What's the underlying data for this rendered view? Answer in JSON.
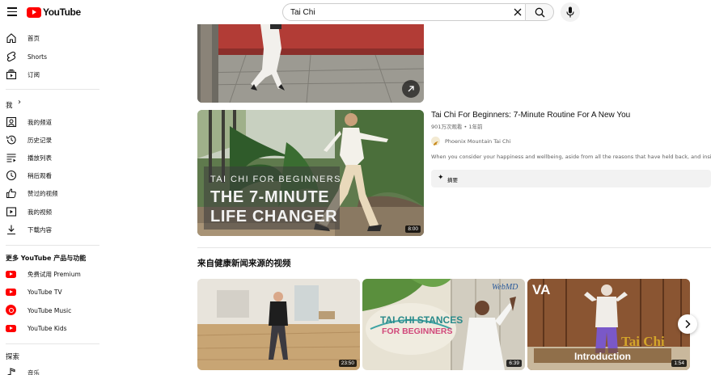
{
  "header": {
    "logo_text": "YouTube",
    "search": {
      "value": "Tai Chi",
      "placeholder": ""
    }
  },
  "sidebar": {
    "main": [
      {
        "label": "首页",
        "icon": "home-icon"
      },
      {
        "label": "Shorts",
        "icon": "shorts-icon"
      },
      {
        "label": "订阅",
        "icon": "subscriptions-icon"
      }
    ],
    "you_title": "我",
    "you_chevron": "›",
    "you": [
      {
        "label": "我的频道",
        "icon": "channel-icon"
      },
      {
        "label": "历史记录",
        "icon": "history-icon"
      },
      {
        "label": "播放列表",
        "icon": "playlists-icon"
      },
      {
        "label": "稍后观看",
        "icon": "watch-later-icon"
      },
      {
        "label": "赞过的视频",
        "icon": "thumb-up-icon"
      },
      {
        "label": "我的视频",
        "icon": "my-videos-icon"
      },
      {
        "label": "下载内容",
        "icon": "download-icon"
      }
    ],
    "more_title": "更多 YouTube 产品与功能",
    "more": [
      {
        "label": "免费试用 Premium",
        "icon": "youtube-premium-icon"
      },
      {
        "label": "YouTube TV",
        "icon": "youtube-tv-icon"
      },
      {
        "label": "YouTube Music",
        "icon": "youtube-music-icon"
      },
      {
        "label": "YouTube Kids",
        "icon": "youtube-kids-icon"
      }
    ],
    "explore_title": "探索",
    "explore": [
      {
        "label": "音乐",
        "icon": "music-icon"
      }
    ]
  },
  "featured_video": {
    "title": "Tai Chi For Beginners: 7-Minute Routine For A New You",
    "meta": "901万次观看 • 1年前",
    "channel": "Phoenix Mountain Tai Chi",
    "description": "When you consider your happiness and wellbeing, aside from all the reasons that have held back, and inside all that y",
    "summary_label": "摘要",
    "duration": "8:00",
    "thumb_text": {
      "line1": "TAI CHI FOR BEGINNERS",
      "line2": "THE 7-MINUTE",
      "line3": "LIFE CHANGER"
    }
  },
  "shelf": {
    "title": "来自健康新闻来源的视频",
    "videos": [
      {
        "duration": "23:50"
      },
      {
        "duration": "6:39",
        "brand": "WebMD",
        "overlay_line1": "TAI CHI STANCES",
        "overlay_line2": "FOR BEGINNERS"
      },
      {
        "duration": "1:54",
        "brand": "VA",
        "overlay_line1": "Tai Chi",
        "overlay_line2": "Introduction"
      }
    ]
  },
  "colors": {
    "brand_red": "#ff0000",
    "text_primary": "#0f0f0f",
    "text_secondary": "#606060",
    "chip_bg": "#f2f2f2"
  }
}
